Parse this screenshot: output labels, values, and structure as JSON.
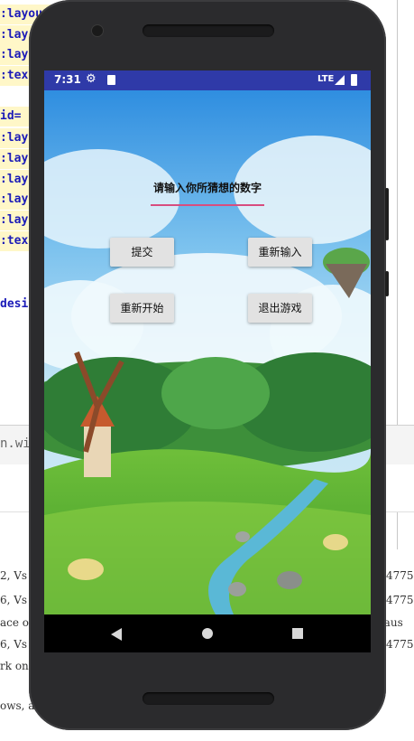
{
  "ide": {
    "code_lines": [
      ":layou",
      ":lay",
      ":lay",
      ":tex",
      "",
      "id=",
      ":lay",
      ":lay",
      ":lay",
      ":lay",
      ":lay",
      ":tex",
      "",
      "",
      "desi"
    ],
    "tab_fragment": "n.wic",
    "log_lines": [
      {
        "left": "2, Vs",
        "right": "4775"
      },
      {
        "left": "6, Vs",
        "right": "4775"
      },
      {
        "left": "ace o",
        "right": "paus"
      },
      {
        "left": "6, Vs",
        "right": "4775"
      },
      {
        "left": "rk on",
        "right": ""
      },
      {
        "left": "ows, a",
        "right": ""
      }
    ]
  },
  "status_bar": {
    "time": "7:31",
    "settings_icon": "gear-icon",
    "sd_icon": "sd-card-icon",
    "network": "LTE",
    "signal_icon": "signal-icon",
    "battery_icon": "battery-icon"
  },
  "app": {
    "prompt": "请输入你所猜想的数字",
    "buttons": {
      "submit": "提交",
      "reinput": "重新输入",
      "restart": "重新开始",
      "exit": "退出游戏"
    }
  },
  "nav": {
    "back_icon": "back-icon",
    "home_icon": "home-icon",
    "recents_icon": "recents-icon"
  },
  "colors": {
    "status_bar": "#2f3aa8",
    "input_underline": "#d84d7f",
    "button_bg": "#e2e2e2",
    "phone_body": "#2b2b2d"
  }
}
